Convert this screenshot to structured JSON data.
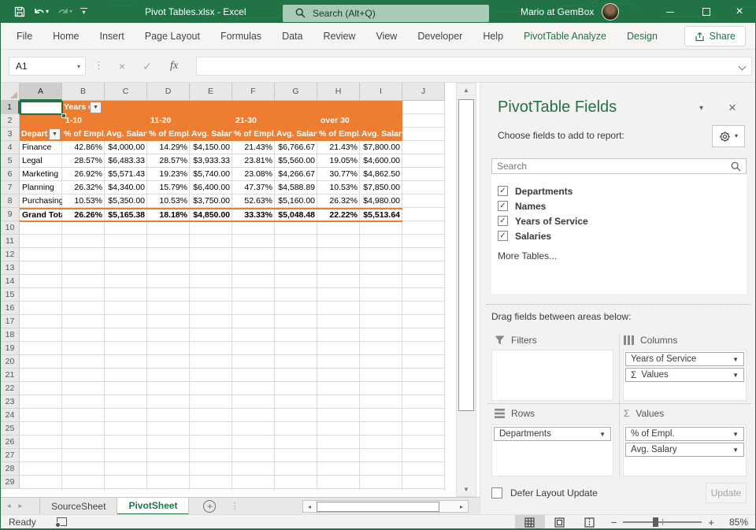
{
  "title_bar": {
    "title": "Pivot Tables.xlsx - Excel",
    "search_placeholder": "Search (Alt+Q)",
    "account_name": "Mario at GemBox"
  },
  "ribbon": {
    "tabs": [
      {
        "label": "File",
        "green": false
      },
      {
        "label": "Home",
        "green": false
      },
      {
        "label": "Insert",
        "green": false
      },
      {
        "label": "Page Layout",
        "green": false
      },
      {
        "label": "Formulas",
        "green": false
      },
      {
        "label": "Data",
        "green": false
      },
      {
        "label": "Review",
        "green": false
      },
      {
        "label": "View",
        "green": false
      },
      {
        "label": "Developer",
        "green": false
      },
      {
        "label": "Help",
        "green": false
      },
      {
        "label": "PivotTable Analyze",
        "green": true
      },
      {
        "label": "Design",
        "green": true
      }
    ],
    "share_label": "Share"
  },
  "formula_bar": {
    "name_box": "A1",
    "fx_label": "fx"
  },
  "sheet": {
    "columns": [
      "A",
      "B",
      "C",
      "D",
      "E",
      "F",
      "G",
      "H",
      "I",
      "J"
    ],
    "selected_column": "A",
    "selected_row": "1",
    "row_labels": [
      "1",
      "2",
      "3",
      "4",
      "5",
      "6",
      "7",
      "8",
      "9",
      "10",
      "11",
      "12",
      "13",
      "14",
      "15",
      "16",
      "17",
      "18",
      "19",
      "20",
      "21",
      "22",
      "23",
      "24",
      "25",
      "26",
      "27",
      "28",
      "29"
    ]
  },
  "pivot": {
    "filter_field_label": "Years of Service",
    "row_field_label": "Departments",
    "groups": [
      "1-10",
      "11-20",
      "21-30",
      "over 30"
    ],
    "value_headers": [
      "% of Empl.",
      "Avg. Salary",
      "% of Empl.",
      "Avg. Salary",
      "% of Empl.",
      "Avg. Salary",
      "% of Empl.",
      "Avg. Salary"
    ],
    "data_rows": [
      {
        "name": "Finance",
        "bold": false,
        "values": [
          "42.86%",
          "$4,000.00",
          "14.29%",
          "$4,150.00",
          "21.43%",
          "$6,766.67",
          "21.43%",
          "$7,800.00"
        ]
      },
      {
        "name": "Legal",
        "bold": false,
        "values": [
          "28.57%",
          "$6,483.33",
          "28.57%",
          "$3,933.33",
          "23.81%",
          "$5,560.00",
          "19.05%",
          "$4,600.00"
        ]
      },
      {
        "name": "Marketing",
        "bold": false,
        "values": [
          "26.92%",
          "$5,571.43",
          "19.23%",
          "$5,740.00",
          "23.08%",
          "$4,266.67",
          "30.77%",
          "$4,862.50"
        ]
      },
      {
        "name": "Planning",
        "bold": false,
        "values": [
          "26.32%",
          "$4,340.00",
          "15.79%",
          "$6,400.00",
          "47.37%",
          "$4,588.89",
          "10.53%",
          "$7,850.00"
        ]
      },
      {
        "name": "Purchasing",
        "bold": false,
        "values": [
          "10.53%",
          "$5,350.00",
          "10.53%",
          "$3,750.00",
          "52.63%",
          "$5,160.00",
          "26.32%",
          "$4,980.00"
        ]
      },
      {
        "name": "Grand Total",
        "bold": true,
        "values": [
          "26.26%",
          "$5,165.38",
          "18.18%",
          "$4,850.00",
          "33.33%",
          "$5,048.48",
          "22.22%",
          "$5,513.64"
        ]
      }
    ]
  },
  "sheet_tabs": {
    "sheets": [
      {
        "name": "SourceSheet",
        "active": false
      },
      {
        "name": "PivotSheet",
        "active": true
      }
    ]
  },
  "status_bar": {
    "mode": "Ready",
    "zoom_level": "85%"
  },
  "pane": {
    "title": "PivotTable Fields",
    "subtitle": "Choose fields to add to report:",
    "search_placeholder": "Search",
    "fields": [
      {
        "label": "Departments",
        "checked": true
      },
      {
        "label": "Names",
        "checked": true
      },
      {
        "label": "Years of Service",
        "checked": true
      },
      {
        "label": "Salaries",
        "checked": true
      }
    ],
    "more_tables_label": "More Tables...",
    "drag_hint": "Drag fields between areas below:",
    "areas": {
      "filters": {
        "label": "Filters",
        "items": []
      },
      "columns": {
        "label": "Columns",
        "items": [
          {
            "label": "Years of Service",
            "sigma": false
          },
          {
            "label": "Values",
            "sigma": true
          }
        ]
      },
      "rows": {
        "label": "Rows",
        "items": [
          {
            "label": "Departments",
            "sigma": false
          }
        ]
      },
      "values": {
        "label": "Values",
        "items": [
          {
            "label": "% of Empl.",
            "sigma": false
          },
          {
            "label": "Avg. Salary",
            "sigma": false
          }
        ]
      }
    },
    "defer_label": "Defer Layout Update",
    "update_label": "Update"
  },
  "icons": {
    "dropdown_glyph": "▾",
    "close_glyph": "×",
    "check_glyph": "✓",
    "sigma_glyph": "Σ",
    "up_glyph": "▲",
    "down_glyph": "▼",
    "left_glyph": "◂",
    "right_glyph": "▸",
    "plus_glyph": "+",
    "minus_glyph": "−",
    "dots_glyph": "⋮"
  },
  "colors": {
    "accent_green": "#217346",
    "pivot_orange": "#ED7D31"
  }
}
